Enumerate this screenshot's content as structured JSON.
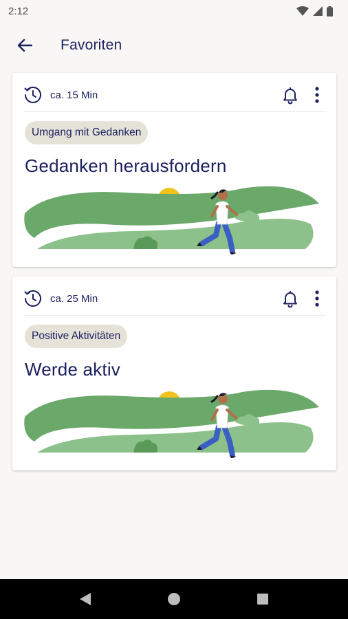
{
  "status_bar": {
    "time": "2:12"
  },
  "app_bar": {
    "title": "Favoriten"
  },
  "cards": [
    {
      "duration": "ca. 15 Min",
      "tag": "Umgang mit Gedanken",
      "title": "Gedanken herausfordern"
    },
    {
      "duration": "ca. 25 Min",
      "tag": "Positive Aktivitäten",
      "title": "Werde aktiv"
    }
  ],
  "colors": {
    "primary": "#1b1f5e",
    "tag_bg": "#e5e2d8",
    "hill_dark": "#6ba96a",
    "hill_light": "#8dc18b",
    "sun": "#f2c21c",
    "runner_pants": "#3b5fc4"
  }
}
